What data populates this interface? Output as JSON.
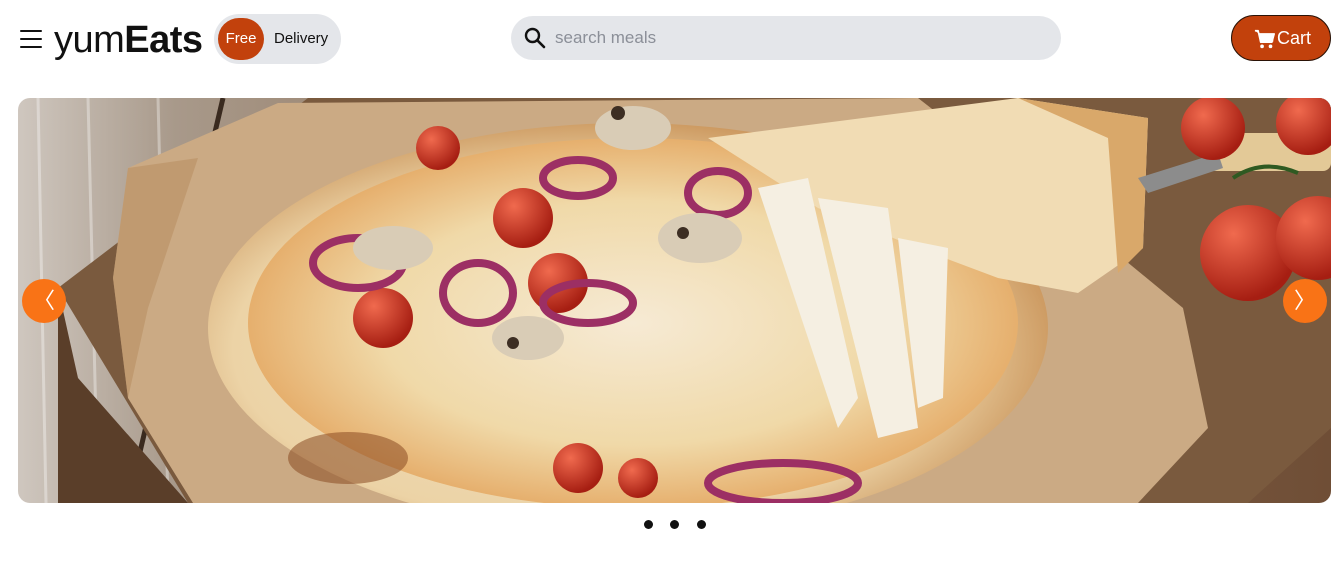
{
  "header": {
    "logo": {
      "light": "yum",
      "bold": "Eats"
    },
    "delivery_toggle": {
      "active": "Free",
      "other": "Delivery"
    },
    "search": {
      "placeholder": "search meals",
      "value": ""
    },
    "cart": {
      "label": "Cart"
    }
  },
  "carousel": {
    "slide_image": "pizza-slice-cheese-pull-photo",
    "prev_icon": "chevron-left-icon",
    "next_icon": "chevron-right-icon",
    "prev_glyph": "〈",
    "next_glyph": "〉",
    "slide_count": 3,
    "active_index": 0
  },
  "colors": {
    "brand": "#c2410c",
    "accent": "#f97316",
    "pill_bg": "#e4e6ea",
    "text": "#111111"
  }
}
